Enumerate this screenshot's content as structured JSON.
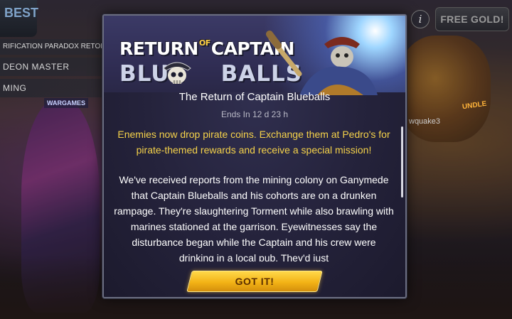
{
  "background": {
    "corner_sign": "BEST",
    "left_menu": [
      "RIFICATION PARADOX RETOLD",
      "DEON MASTER",
      "MING"
    ],
    "wargames_label": "WARGAMES",
    "free_gold_label": "FREE GOLD!",
    "info_label": "i",
    "bundle_label": "UNDLE",
    "player_name": "wquake3"
  },
  "modal": {
    "logo": {
      "line1_a": "RETURN",
      "line1_of": "OF",
      "line1_b": "CAPTAIN",
      "line2_a": "BLUE",
      "line2_b": "BALLS"
    },
    "title": "The Return of Captain Blueballs",
    "ends_in": "Ends In 12 d 23 h",
    "highlight": "Enemies now drop pirate coins. Exchange them at Pedro's for pirate-themed rewards and receive a special mission!",
    "story": "We've received reports from the mining colony on Ganymede that Captain Blueballs and his cohorts are on a drunken rampage. They're slaughtering Torment while also brawling with marines stationed at the garrison. Eyewitnesses say the disturbance began while the Captain and his crew were drinking in a local pub. They'd just",
    "button_label": "GOT IT!"
  },
  "colors": {
    "highlight_text": "#f5d24a",
    "button_fill": "#f3b316",
    "modal_bg": "#25233c"
  }
}
